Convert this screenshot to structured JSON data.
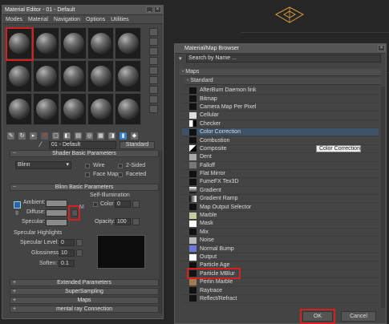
{
  "material_editor": {
    "title": "Material Editor - 01 - Default",
    "menu": [
      "Modes",
      "Material",
      "Navigation",
      "Options",
      "Utilities"
    ],
    "material_name": "01 - Default",
    "standard_button": "Standard",
    "shader_basic": {
      "header": "Shader Basic Parameters",
      "shader": "Blinn",
      "options": [
        "Wire",
        "2-Sided",
        "Face Map",
        "Faceted"
      ]
    },
    "blinn_basic": {
      "header": "Blinn Basic Parameters",
      "self_illum_group": "Self-Illumination",
      "color_label": "Color",
      "color_value": "0",
      "ambient_label": "Ambient:",
      "diffuse_label": "Diffuse:",
      "specular_label": "Specular:",
      "opacity_label": "Opacity:",
      "opacity_value": "100"
    },
    "highlights": {
      "group": "Specular Highlights",
      "specular_level_label": "Specular Level:",
      "specular_level_value": "0",
      "glossiness_label": "Glossiness:",
      "glossiness_value": "10",
      "soften_label": "Soften:",
      "soften_value": "0.1"
    },
    "rollouts": [
      "Extended Parameters",
      "SuperSampling",
      "Maps",
      "mental ray Connection"
    ]
  },
  "browser": {
    "title": "Material/Map Browser",
    "search_placeholder": "Search by Name ...",
    "maps_group": "- Maps",
    "standard_group": "- Standard",
    "items": [
      "AfterBurn Daemon link",
      "Bitmap",
      "Camera Map Per Pixel",
      "Cellular",
      "Checker",
      "Color Correction",
      "Combustion",
      "Composite",
      "Dent",
      "Falloff",
      "Flat Mirror",
      "FumeFX Tex3D",
      "Gradient",
      "Gradient Ramp",
      "Map Output Selector",
      "Marble",
      "Mask",
      "Mix",
      "Noise",
      "Normal Bump",
      "Output",
      "Particle Age",
      "Particle MBlur",
      "Perlin Marble",
      "Raytrace",
      "Reflect/Refract"
    ],
    "tooltip": "Color Correction",
    "ok_label": "OK",
    "cancel_label": "Cancel"
  },
  "colors": {
    "highlight": "#d62020",
    "selection": "#3b5267"
  }
}
